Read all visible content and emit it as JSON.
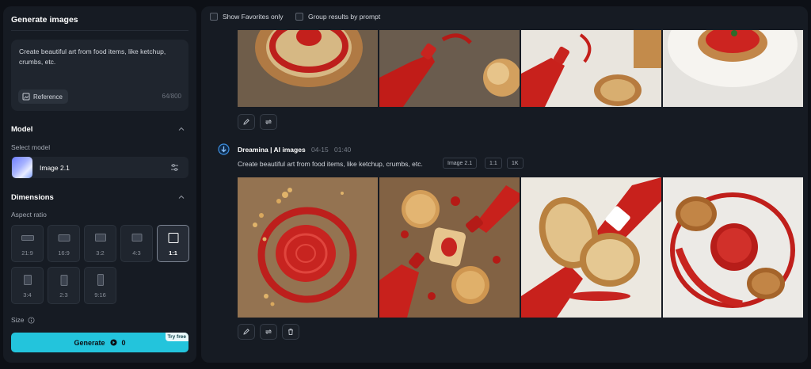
{
  "sidebar": {
    "title": "Generate images",
    "prompt": {
      "text": "Create beautiful art from food items, like ketchup, crumbs, etc.",
      "reference_label": "Reference",
      "counter": "64/800"
    },
    "model_section": {
      "title": "Model",
      "select_label": "Select model",
      "selected_model": "Image 2.1"
    },
    "dimensions_section": {
      "title": "Dimensions",
      "aspect_label": "Aspect ratio",
      "ratios": [
        "21:9",
        "16:9",
        "3:2",
        "4:3",
        "1:1",
        "3:4",
        "2:3",
        "9:16"
      ],
      "selected_ratio": "1:1"
    },
    "size_label": "Size",
    "generate": {
      "label": "Generate",
      "credits": "0",
      "badge": "Try free"
    }
  },
  "filters": {
    "show_favorites": "Show Favorites only",
    "group_by_prompt": "Group results by prompt"
  },
  "generation": {
    "author": "Dreamina | AI images",
    "date": "04-15",
    "time": "01:40",
    "prompt": "Create beautiful art from food items, like ketchup, crumbs, etc.",
    "tags": [
      "Image 2.1",
      "1:1",
      "1K"
    ]
  },
  "colors": {
    "accent": "#23c4dc",
    "panel": "#161b23",
    "ketchup": "#c3201c"
  }
}
